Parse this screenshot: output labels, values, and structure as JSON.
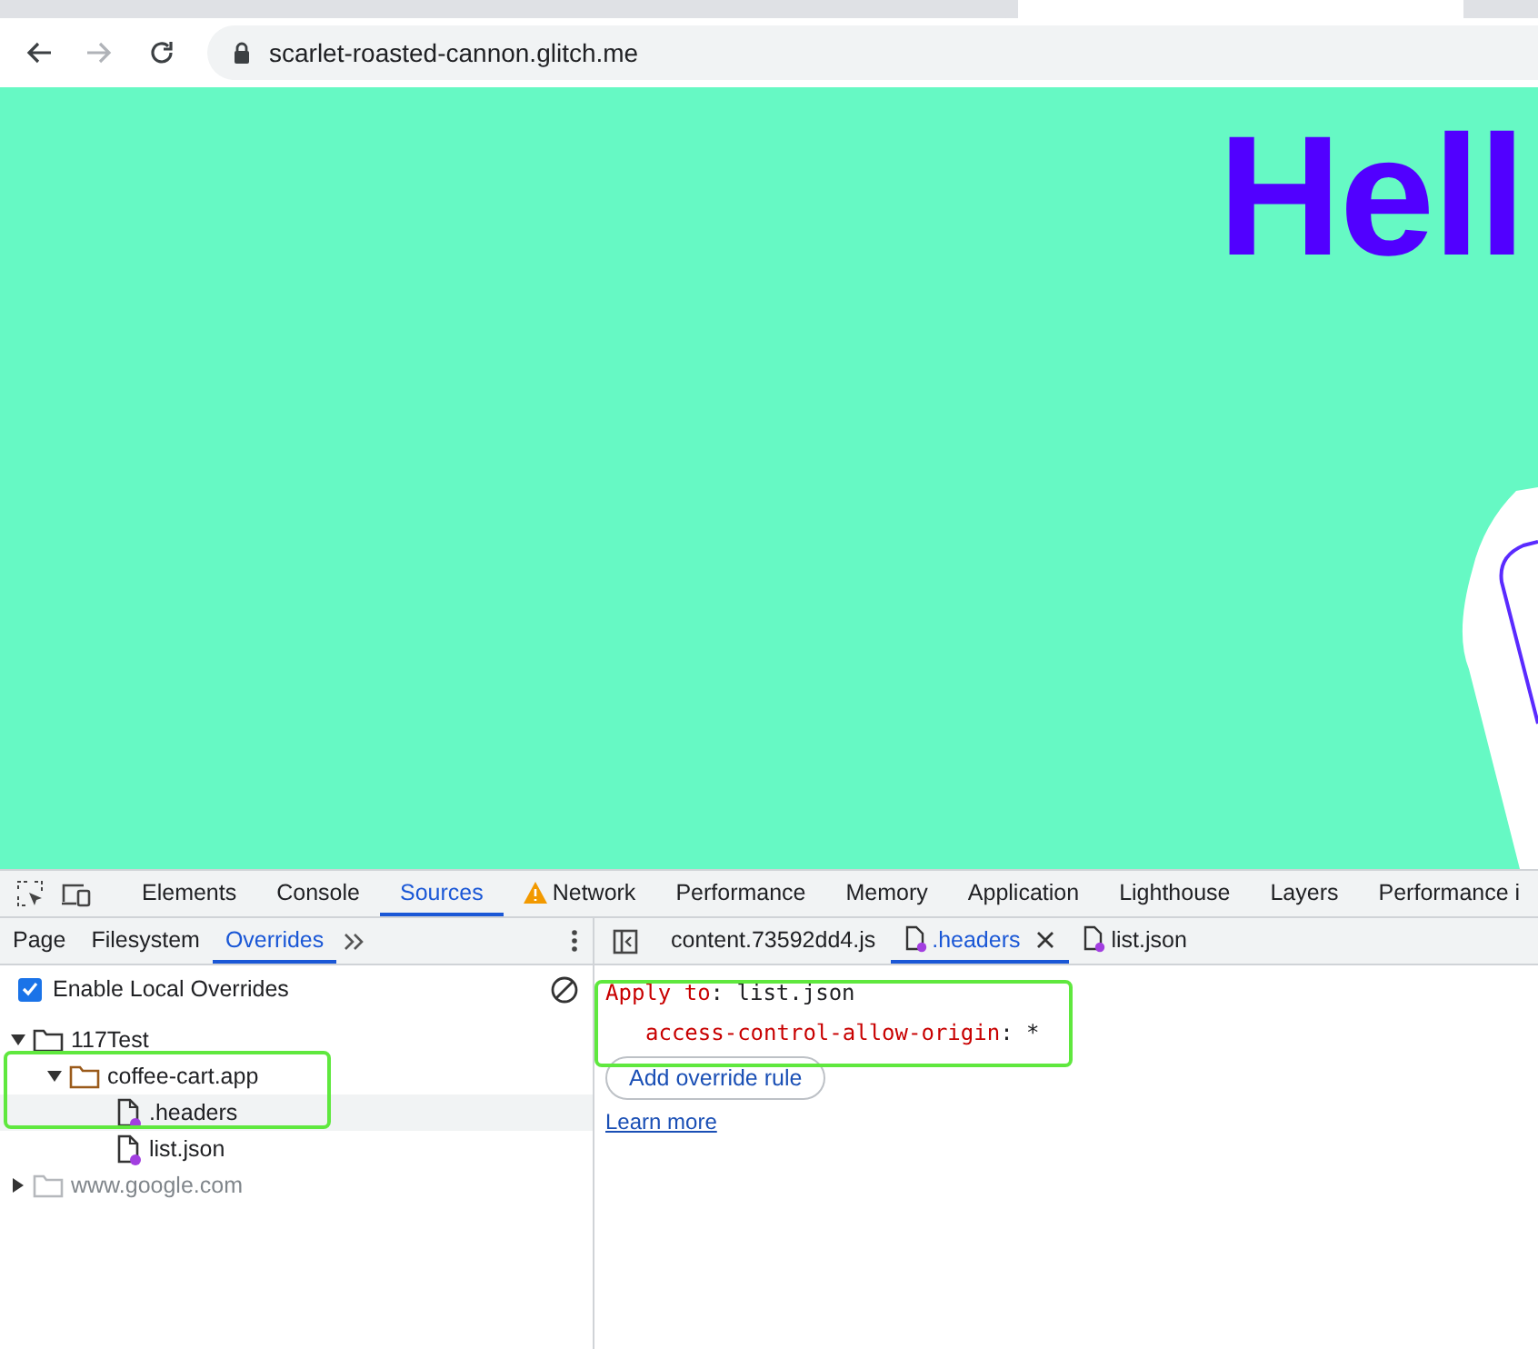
{
  "browser": {
    "nav_buttons": [
      {
        "kind": "back",
        "disabled": false
      },
      {
        "kind": "forward",
        "disabled": true
      },
      {
        "kind": "reload",
        "disabled": false
      }
    ],
    "url": "scarlet-roasted-cannon.glitch.me"
  },
  "page": {
    "heading": "Hell"
  },
  "devtools": {
    "main_tabs": [
      {
        "label": "Elements",
        "selected": false,
        "warning": false
      },
      {
        "label": "Console",
        "selected": false,
        "warning": false
      },
      {
        "label": "Sources",
        "selected": true,
        "warning": false
      },
      {
        "label": "Network",
        "selected": false,
        "warning": true
      },
      {
        "label": "Performance",
        "selected": false,
        "warning": false
      },
      {
        "label": "Memory",
        "selected": false,
        "warning": false
      },
      {
        "label": "Application",
        "selected": false,
        "warning": false
      },
      {
        "label": "Lighthouse",
        "selected": false,
        "warning": false
      },
      {
        "label": "Layers",
        "selected": false,
        "warning": false
      },
      {
        "label": "Performance i",
        "selected": false,
        "warning": false
      }
    ],
    "navigator_tabs": [
      {
        "label": "Page",
        "selected": false
      },
      {
        "label": "Filesystem",
        "selected": false
      },
      {
        "label": "Overrides",
        "selected": true
      }
    ],
    "editor_tabs": [
      {
        "label": "content.73592dd4.js",
        "kind": "plain",
        "selected": false,
        "closable": false
      },
      {
        "label": ".headers",
        "kind": "override",
        "selected": true,
        "closable": true
      },
      {
        "label": "list.json",
        "kind": "override",
        "selected": false,
        "closable": false
      }
    ],
    "enable_overrides": {
      "label": "Enable Local Overrides",
      "checked": true
    },
    "tree": [
      {
        "label": "117Test",
        "kind": "folder",
        "expanded": true,
        "selected": false,
        "disabled": false,
        "children": [
          {
            "label": "coffee-cart.app",
            "kind": "domain",
            "expanded": true,
            "selected": false,
            "disabled": false,
            "children": [
              {
                "label": ".headers",
                "kind": "file",
                "selected": true,
                "disabled": false
              },
              {
                "label": "list.json",
                "kind": "file",
                "selected": false,
                "disabled": false
              }
            ]
          }
        ]
      },
      {
        "label": "www.google.com",
        "kind": "domain",
        "expanded": false,
        "selected": false,
        "disabled": true
      }
    ],
    "editor_lines": [
      {
        "key": "Apply to",
        "separator": ":",
        "value": "list.json",
        "indented": false
      },
      {
        "key": "access-control-allow-origin",
        "separator": ":",
        "value": "*",
        "indented": true
      }
    ],
    "add_button": "Add override rule",
    "learn_more": "Learn more"
  }
}
